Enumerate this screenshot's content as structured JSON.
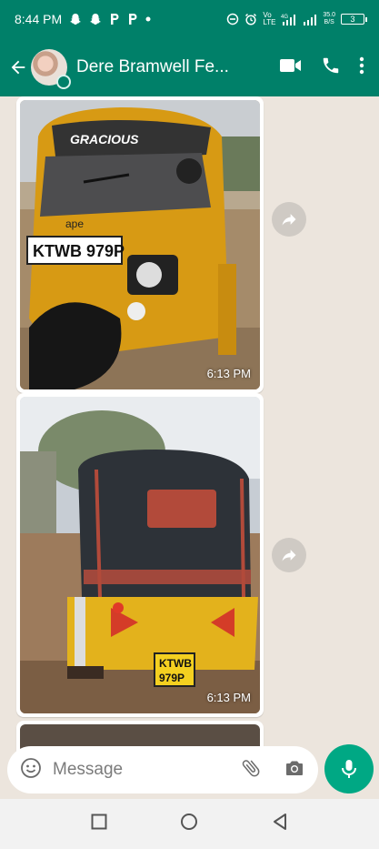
{
  "status_bar": {
    "time": "8:44 PM",
    "network_label": "Vo LTE",
    "speed_value": "35.0",
    "speed_unit": "B/S",
    "battery_level": "3"
  },
  "header": {
    "contact_name": "Dere Bramwell Fe..."
  },
  "messages": [
    {
      "type": "image",
      "time": "6:13 PM"
    },
    {
      "type": "image",
      "time": "6:13 PM"
    }
  ],
  "composer": {
    "placeholder": "Message"
  },
  "icons": {
    "back": "arrow-left-icon",
    "video": "video-camera-icon",
    "call": "phone-icon",
    "menu": "more-vert-icon",
    "emoji": "emoji-icon",
    "attach": "paperclip-icon",
    "camera": "camera-icon",
    "mic": "microphone-icon",
    "forward": "forward-icon"
  },
  "colors": {
    "header": "#008069",
    "chat_bg": "#ece5dd",
    "mic_button": "#00a884"
  }
}
